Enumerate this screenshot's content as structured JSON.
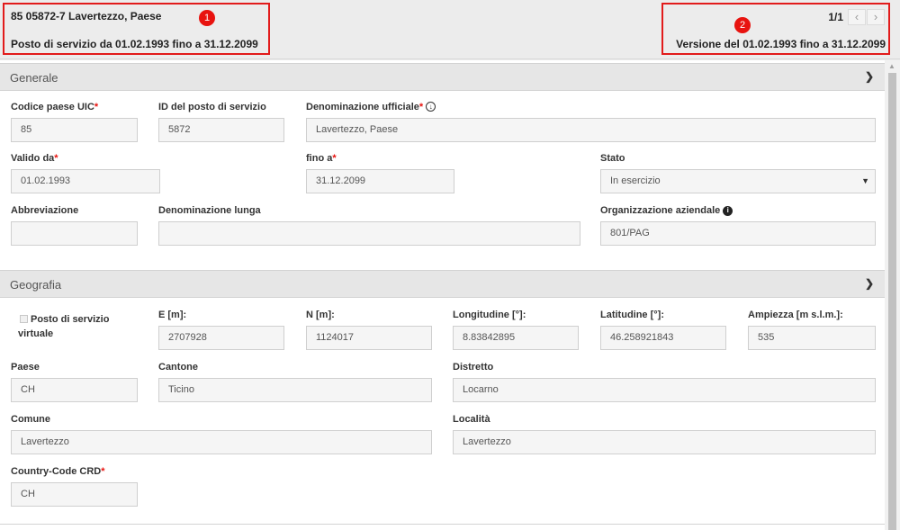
{
  "header": {
    "title": "85 05872-7 Lavertezzo, Paese",
    "subtitle": "Posto di servizio da 01.02.1993 fino a 31.12.2099",
    "pager_count": "1/1",
    "prev_icon": "chevron-left",
    "next_icon": "chevron-right",
    "version": "Versione del 01.02.1993 fino a 31.12.2099",
    "marker_1": "1",
    "marker_2": "2"
  },
  "generale": {
    "title": "Generale",
    "uic_label": "Codice paese UIC",
    "uic_value": "85",
    "id_label": "ID del posto di servizio",
    "id_value": "5872",
    "denom_label": "Denominazione ufficiale",
    "denom_value": "Lavertezzo, Paese",
    "valid_from_label": "Valido da",
    "valid_from_value": "01.02.1993",
    "valid_to_label": "fino a",
    "valid_to_value": "31.12.2099",
    "stato_label": "Stato",
    "stato_value": "In esercizio",
    "abbrev_label": "Abbreviazione",
    "abbrev_value": "",
    "long_label": "Denominazione lunga",
    "long_value": "",
    "org_label": "Organizzazione aziendale",
    "org_value": "801/PAG",
    "required_mark": "*"
  },
  "geografia": {
    "title": "Geografia",
    "virtual_label": "Posto di servizio virtuale",
    "e_label": "E [m]:",
    "e_value": "2707928",
    "n_label": "N [m]:",
    "n_value": "1124017",
    "lon_label": "Longitudine [°]:",
    "lon_value": "8.83842895",
    "lat_label": "Latitudine [°]:",
    "lat_value": "46.258921843",
    "alt_label": "Ampiezza [m s.l.m.]:",
    "alt_value": "535",
    "paese_label": "Paese",
    "paese_value": "CH",
    "cantone_label": "Cantone",
    "cantone_value": "Ticino",
    "distretto_label": "Distretto",
    "distretto_value": "Locarno",
    "comune_label": "Comune",
    "comune_value": "Lavertezzo",
    "localita_label": "Località",
    "localita_value": "Lavertezzo",
    "crd_label": "Country-Code CRD",
    "crd_value": "CH"
  },
  "colors": {
    "accent_red": "#e8130f",
    "section_bg": "#e6e6e6"
  }
}
